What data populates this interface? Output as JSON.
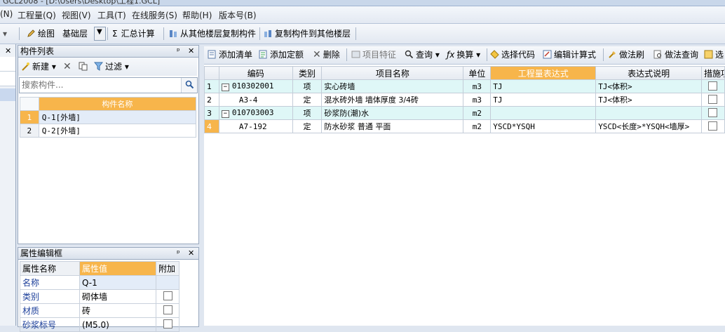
{
  "window": {
    "title": "GCL2008 - [D:\\Users\\Desktop\\工程1.GCL]"
  },
  "menu": [
    "(N)",
    "工程量(Q)",
    "视图(V)",
    "工具(T)",
    "在线服务(S)",
    "帮助(H)",
    "版本号(B)"
  ],
  "toolbar": {
    "draw": "绘图",
    "floor": "基础层",
    "sum": "汇总计算",
    "copy_from": "从其他楼层复制构件",
    "copy_to": "复制构件到其他楼层"
  },
  "component_list": {
    "title": "构件列表",
    "new": "新建",
    "filter": "过滤",
    "search_placeholder": "搜索构件...",
    "column": "构件名称",
    "rows": [
      {
        "num": "1",
        "name": "Q-1[外墙]"
      },
      {
        "num": "2",
        "name": "Q-2[外墙]"
      }
    ]
  },
  "property_editor": {
    "title": "属性编辑框",
    "headers": [
      "属性名称",
      "属性值",
      "附加"
    ],
    "rows": [
      {
        "name": "名称",
        "value": "Q-1"
      },
      {
        "name": "类别",
        "value": "砌体墙"
      },
      {
        "name": "材质",
        "value": "砖"
      },
      {
        "name": "砂浆标号",
        "value": "(M5.0)"
      }
    ]
  },
  "right_toolbar": {
    "add_list": "添加清单",
    "add_quota": "添加定额",
    "delete": "删除",
    "item_feature": "项目特征",
    "query": "查询",
    "convert": "换算",
    "select_code": "选择代码",
    "edit_formula": "编辑计算式",
    "method_brush": "做法刷",
    "method_query": "做法查询",
    "more": "选"
  },
  "main_table": {
    "headers": [
      "编码",
      "类别",
      "项目名称",
      "单位",
      "工程量表达式",
      "表达式说明",
      "措施项目"
    ],
    "rows": [
      {
        "num": "1",
        "code": "010302001",
        "type": "项",
        "name": "实心砖墙",
        "unit": "m3",
        "expr": "TJ",
        "desc": "TJ<体积>"
      },
      {
        "num": "2",
        "code": "A3-4",
        "type": "定",
        "name": "混水砖外墙 墙体厚度 3/4砖",
        "unit": "m3",
        "expr": "TJ",
        "desc": "TJ<体积>"
      },
      {
        "num": "3",
        "code": "010703003",
        "type": "项",
        "name": "砂浆防(潮)水",
        "unit": "m2",
        "expr": "",
        "desc": ""
      },
      {
        "num": "4",
        "code": "A7-192",
        "type": "定",
        "name": "防水砂浆 普通 平面",
        "unit": "m2",
        "expr": "YSCD*YSQH",
        "desc": "YSCD<长度>*YSQH<墙厚>"
      }
    ]
  }
}
